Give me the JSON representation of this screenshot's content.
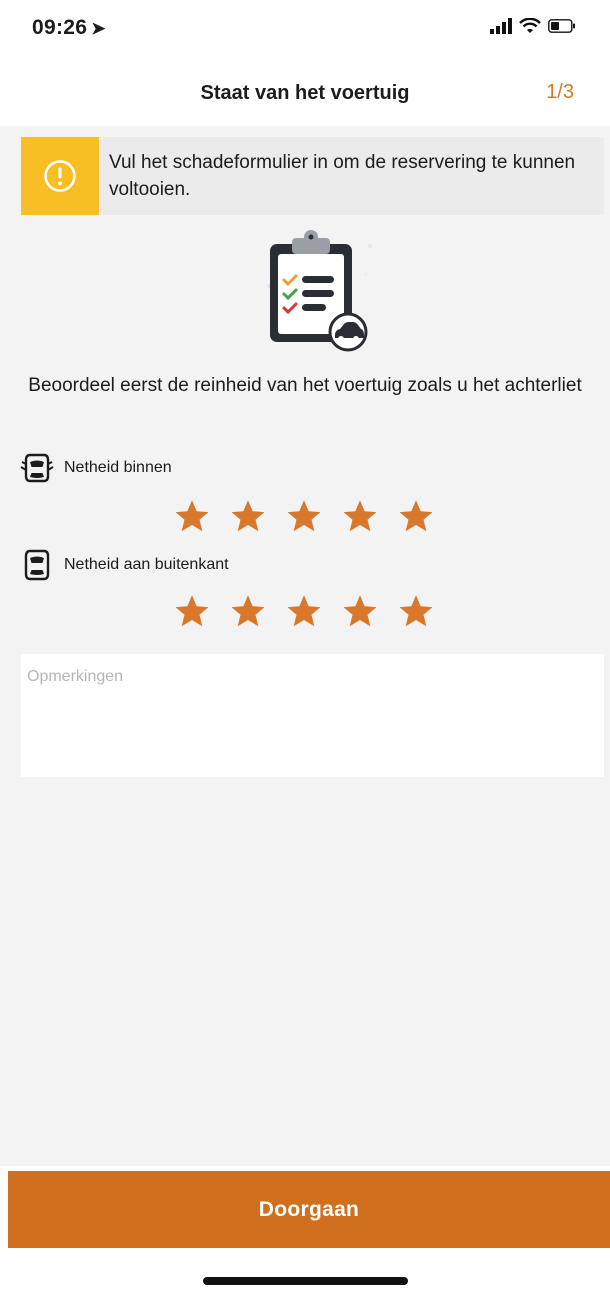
{
  "status_bar": {
    "time": "09:26",
    "location_icon": "location-arrow-icon",
    "signal_icon": "cellular-signal-icon",
    "wifi_icon": "wifi-icon",
    "battery_icon": "battery-icon"
  },
  "nav": {
    "title": "Staat van het voertuig",
    "step": "1/3"
  },
  "banner": {
    "icon": "warning-circle-icon",
    "text": "Vul het schadeformulier in om de reservering te kunnen voltooien.",
    "accent_color": "#f7bf24"
  },
  "illustration": {
    "icon": "clipboard-checklist-car-icon"
  },
  "instruction": "Beoordeel eerst de reinheid van het voertuig zoals u het achterliet",
  "ratings": [
    {
      "label": "Netheid binnen",
      "icon": "car-interior-icon",
      "stars": 5,
      "max": 5
    },
    {
      "label": "Netheid aan buitenkant",
      "icon": "car-exterior-icon",
      "stars": 5,
      "max": 5
    }
  ],
  "remarks": {
    "placeholder": "Opmerkingen",
    "value": ""
  },
  "continue_button": {
    "label": "Doorgaan",
    "color": "#d06f1e"
  },
  "colors": {
    "accent": "#d9782a",
    "star": "#d9782a",
    "background": "#f3f3f3"
  }
}
